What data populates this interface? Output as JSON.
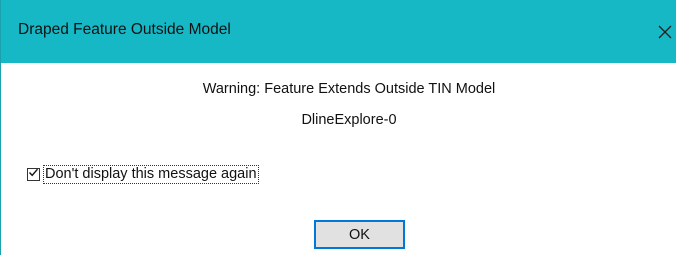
{
  "window": {
    "title": "Draped Feature Outside Model",
    "titlebar_color": "#16b8c6"
  },
  "message": {
    "warning": "Warning: Feature Extends Outside TIN Model",
    "feature_name": "DlineExplore-0"
  },
  "checkbox": {
    "label": "Don't display this message again",
    "checked": true
  },
  "buttons": {
    "ok_label": "OK"
  },
  "icons": {
    "close": "close-icon",
    "check": "checkmark-icon"
  }
}
